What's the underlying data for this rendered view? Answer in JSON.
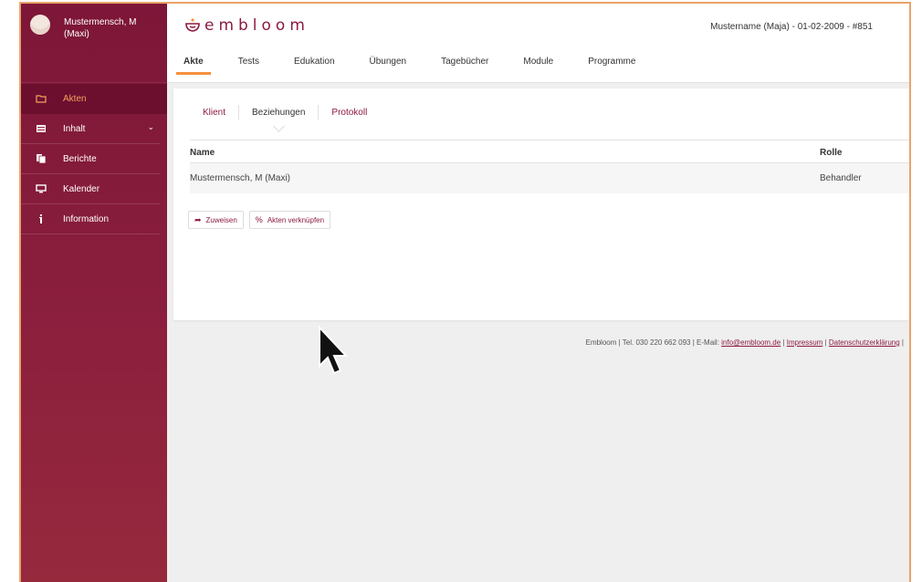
{
  "user": {
    "name_line1": "Mustermensch, M",
    "name_line2": "(Maxi)"
  },
  "sidebar": {
    "items": [
      {
        "label": "Akten",
        "icon": "folder-icon",
        "active": true
      },
      {
        "label": "Inhalt",
        "icon": "list-icon",
        "has_submenu": true
      },
      {
        "label": "Berichte",
        "icon": "document-icon"
      },
      {
        "label": "Kalender",
        "icon": "monitor-icon"
      },
      {
        "label": "Information",
        "icon": "info-icon"
      }
    ]
  },
  "header": {
    "logo_text": "embloom",
    "patient_info": "Mustername (Maja) - 01-02-2009 - #851",
    "tabs": [
      "Akte",
      "Tests",
      "Edukation",
      "Übungen",
      "Tagebücher",
      "Module",
      "Programme"
    ],
    "active_tab": "Akte"
  },
  "subtabs": {
    "items": [
      "Klient",
      "Beziehungen",
      "Protokoll"
    ],
    "selected": "Beziehungen"
  },
  "table": {
    "columns": [
      "Name",
      "Rolle"
    ],
    "rows": [
      {
        "name": "Mustermensch, M (Maxi)",
        "role": "Behandler"
      }
    ]
  },
  "actions": {
    "assign_label": "Zuweisen",
    "link_label": "Akten verknüpfen"
  },
  "footer": {
    "text": "Embloom | Tel. 030 220 662 093 | E-Mail:",
    "email": "info@embloom.de",
    "sep": "|",
    "impressum": "Impressum",
    "privacy": "Datenschutzerklärung"
  },
  "colors": {
    "brand": "#8c1b3f",
    "accent": "#f5913e",
    "sidebar_active_text": "#f7a15e"
  }
}
